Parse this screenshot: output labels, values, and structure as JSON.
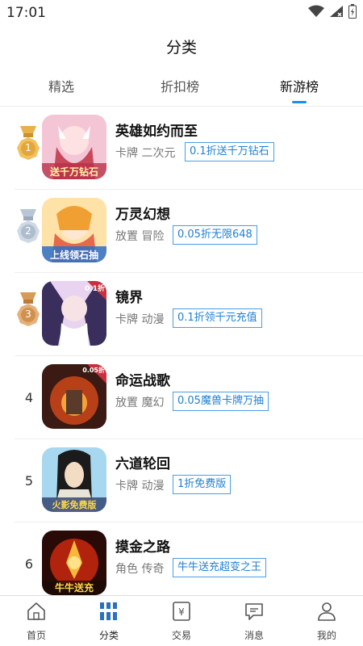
{
  "status_bar": {
    "time": "17:01"
  },
  "header": {
    "title": "分类"
  },
  "tabs": [
    {
      "label": "精选",
      "active": false
    },
    {
      "label": "折扣榜",
      "active": false
    },
    {
      "label": "新游榜",
      "active": true
    }
  ],
  "games": [
    {
      "rank": "1",
      "name": "英雄如约而至",
      "tags": "卡牌 二次元",
      "promo": "0.1折送千万钻石",
      "icon_caption": "送千万钻石"
    },
    {
      "rank": "2",
      "name": "万灵幻想",
      "tags": "放置 冒险",
      "promo": "0.05折无限648",
      "icon_caption": "上线领石抽"
    },
    {
      "rank": "3",
      "name": "镜界",
      "tags": "卡牌 动漫",
      "promo": "0.1折领千元充值",
      "icon_caption": "0.1折"
    },
    {
      "rank": "4",
      "name": "命运战歌",
      "tags": "放置 魔幻",
      "promo": "0.05魔兽卡牌万抽",
      "icon_caption": "0.05折"
    },
    {
      "rank": "5",
      "name": "六道轮回",
      "tags": "卡牌 动漫",
      "promo": "1折免费版",
      "icon_caption": "火影免费版"
    },
    {
      "rank": "6",
      "name": "摸金之路",
      "tags": "角色 传奇",
      "promo": "牛牛送充超变之王",
      "icon_caption": "牛牛送充"
    }
  ],
  "bottom_nav": [
    {
      "label": "首页",
      "icon": "home-icon",
      "active": false
    },
    {
      "label": "分类",
      "icon": "category-grid-icon",
      "active": true
    },
    {
      "label": "交易",
      "icon": "trade-yen-icon",
      "active": false
    },
    {
      "label": "消息",
      "icon": "message-icon",
      "active": false
    },
    {
      "label": "我的",
      "icon": "profile-icon",
      "active": false
    }
  ],
  "colors": {
    "accent": "#1f8de6",
    "gold": "#e8b14a",
    "silver": "#b9c6d6",
    "bronze": "#d99a55"
  }
}
